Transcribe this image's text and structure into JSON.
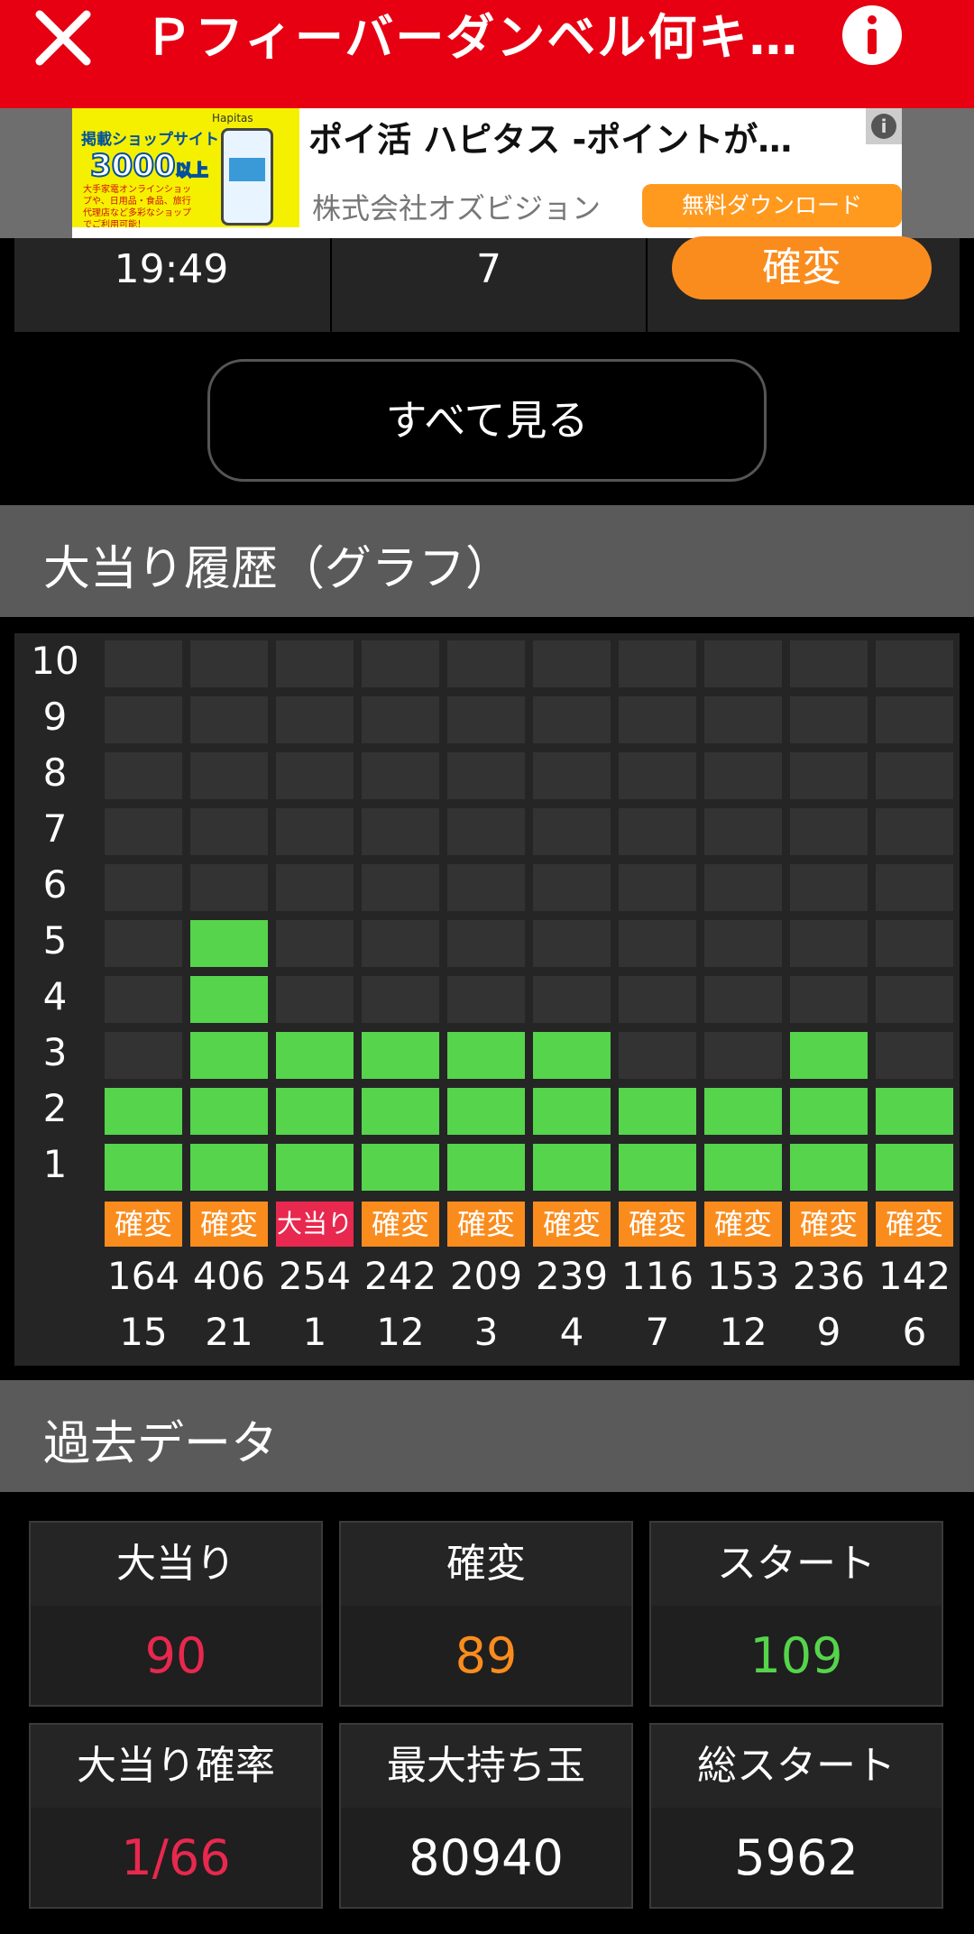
{
  "header": {
    "title": "Ｐフィーバーダンベル何キロ…",
    "close_icon": "close-icon",
    "info_icon": "info-icon",
    "background": "#e60012"
  },
  "ad": {
    "thumb_line1": "掲載ショップサイト",
    "thumb_count": "3000",
    "thumb_count_suffix": "以上",
    "thumb_text": "大手家電オンラインショップや、日用品・食品、旅行代理店など多彩なショップでご利用可能！",
    "thumb_brand": "Hapitas",
    "title": "ポイ活 ハピタス -ポイントが…",
    "company": "株式会社オズビジョン",
    "cta": "無料ダウンロード"
  },
  "history_row": {
    "time": "19:49",
    "count": "7",
    "type": "確変"
  },
  "see_all_label": "すべて見る",
  "graph_section_title": "大当り履歴（グラフ）",
  "chart_data": {
    "type": "bar",
    "y_labels": [
      "10",
      "9",
      "8",
      "7",
      "6",
      "5",
      "4",
      "3",
      "2",
      "1"
    ],
    "ylim": [
      0,
      10
    ],
    "values": [
      2,
      5,
      3,
      3,
      3,
      3,
      2,
      2,
      3,
      2
    ],
    "types": [
      "確変",
      "確変",
      "大当り",
      "確変",
      "確変",
      "確変",
      "確変",
      "確変",
      "確変",
      "確変"
    ],
    "starts": [
      "164",
      "406",
      "254",
      "242",
      "209",
      "239",
      "116",
      "153",
      "236",
      "142"
    ],
    "counts": [
      "15",
      "21",
      "1",
      "12",
      "3",
      "4",
      "7",
      "12",
      "9",
      "6"
    ],
    "colors": {
      "filled": "#55d44c",
      "empty": "#333333",
      "kakuhen": "#fa8c1e",
      "oatari": "#e8284e"
    }
  },
  "past_section_title": "過去データ",
  "past": [
    {
      "label": "大当り",
      "value": "90",
      "color": "#e8284e"
    },
    {
      "label": "確変",
      "value": "89",
      "color": "#fa8c1e"
    },
    {
      "label": "スタート",
      "value": "109",
      "color": "#55d44c"
    },
    {
      "label": "大当り確率",
      "value": "1/66",
      "color": "#e8284e"
    },
    {
      "label": "最大持ち玉",
      "value": "80940",
      "color": "#ffffff"
    },
    {
      "label": "総スタート",
      "value": "5962",
      "color": "#ffffff"
    }
  ]
}
